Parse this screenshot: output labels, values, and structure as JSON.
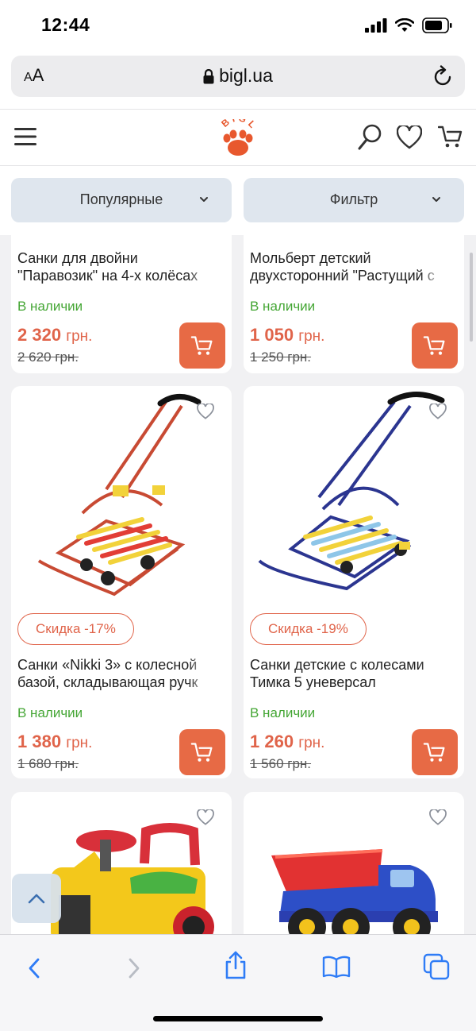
{
  "status_bar": {
    "time": "12:44"
  },
  "address_bar": {
    "aa_small": "A",
    "aa_large": "A",
    "url": "bigl.ua"
  },
  "header": {
    "logo_text": "BIGL"
  },
  "controls": {
    "sort_label": "Популярные",
    "filter_label": "Фильтр"
  },
  "products": [
    {
      "title_line1": "Санки для двойни",
      "title_line2": "\"Паравозик\" на 4-х колёсах",
      "stock": "В наличии",
      "price": "2 320",
      "currency": "грн.",
      "old_price": "2 620 грн."
    },
    {
      "title_line1": "Мольберт детский",
      "title_line2": "двухсторонний \"Растущий с",
      "stock": "В наличии",
      "price": "1 050",
      "currency": "грн.",
      "old_price": "1 250 грн."
    },
    {
      "badge": "Скидка -17%",
      "title_line1": "Санки «Nikki 3» с колесной",
      "title_line2": "базой, складывающая ручк",
      "stock": "В наличии",
      "price": "1 380",
      "currency": "грн.",
      "old_price": "1 680 грн."
    },
    {
      "badge": "Скидка -19%",
      "title_line1": "Санки детские с колесами",
      "title_line2": "Тимка 5 уневерсал",
      "stock": "В наличии",
      "price": "1 260",
      "currency": "грн.",
      "old_price": "1 560 грн."
    },
    {
      "image": "yellow-ride-on-car"
    },
    {
      "image": "toy-dump-truck"
    }
  ],
  "colors": {
    "accent": "#e0644a",
    "stock": "#44a634",
    "button_bg": "#dfe6ee"
  }
}
